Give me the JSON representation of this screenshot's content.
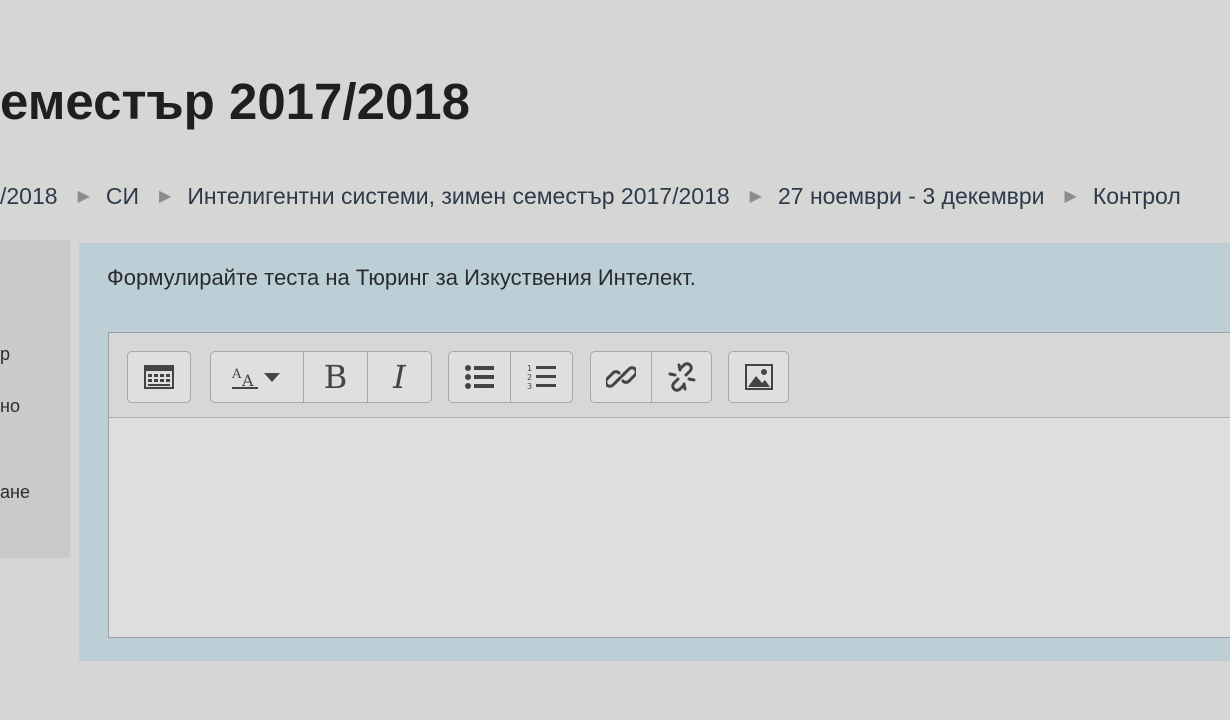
{
  "page": {
    "title": "еместър 2017/2018"
  },
  "breadcrumb": {
    "items": [
      "/2018",
      "СИ",
      "Интелигентни системи, зимен семестър 2017/2018",
      "27 ноември - 3 декември",
      "Контрол"
    ],
    "separator": "▶"
  },
  "left_panel": {
    "items": [
      "р",
      "но",
      "ане"
    ]
  },
  "question": {
    "text": "Формулирайте теста на Тюринг за Изкуствения Интелект."
  },
  "editor": {
    "toolbar": {
      "show_more": "toolbar-toggle-icon",
      "font_size": "font-size-icon",
      "bold_label": "B",
      "italic_label": "I",
      "unordered_list": "unordered-list-icon",
      "ordered_list": "ordered-list-icon",
      "link": "link-icon",
      "unlink": "unlink-icon",
      "image": "image-icon"
    },
    "content": ""
  },
  "colors": {
    "background": "#d6d7d5",
    "question_panel": "#bccfd6",
    "editor_bg": "#dcdedf"
  }
}
